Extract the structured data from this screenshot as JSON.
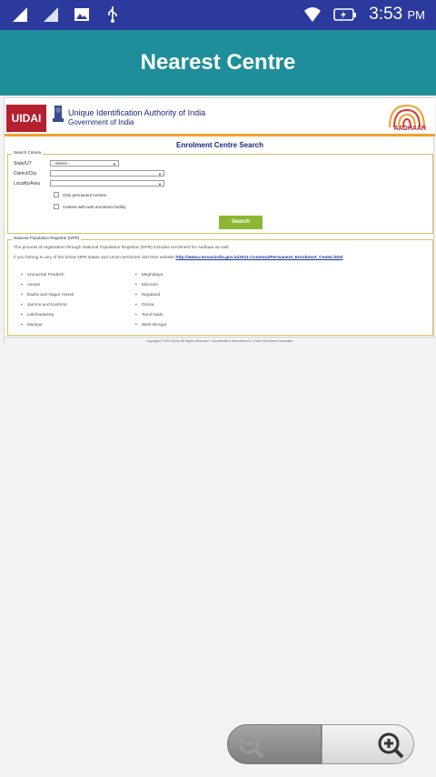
{
  "status_bar": {
    "time": "3:53",
    "ampm": "PM",
    "icons": [
      "signal-icon",
      "signal-r-icon",
      "image-icon",
      "usb-icon",
      "wifi-icon",
      "battery-icon"
    ]
  },
  "app_bar": {
    "title": "Nearest Centre"
  },
  "webpage": {
    "header": {
      "logo_text": "UIDAI",
      "authority_name": "Unique Identification Authority of India",
      "government_name": "Government of India",
      "aadhaar_logo_text": "AADHAAR"
    },
    "section_title": "Enrolment Centre Search",
    "search_criteria": {
      "legend": "Search Criteria",
      "state_label": "State/UT",
      "state_value": "--Select--",
      "district_label": "District/City",
      "district_value": "",
      "locality_label": "Locality/Area",
      "locality_value": "",
      "checkbox_permanent": "Only permanent centres",
      "checkbox_enrolment": "Centres with web enrolment facility",
      "search_button": "Search"
    },
    "npr": {
      "legend": "National Population Registrar (NPR)",
      "line1": "The process of registration through National Population Registrar (NPR) includes enrolment for Aadhaar as well.",
      "line2_prefix": "If you belong to any of the below NPR states and Union territories visit their website",
      "line2_link": "http://www.censusindia.gov.in/2011-Common/Permanent_Enrolment_Center.html",
      "states_col1": [
        "Arunachal Pradesh",
        "Assam",
        "Dadra and Nagar Haveli",
        "Jammu and Kashmir",
        "Lakshadweep",
        "Manipur"
      ],
      "states_col2": [
        "Meghalaya",
        "Mizoram",
        "Nagaland",
        "Orissa",
        "Tamil Nadu",
        "West Bengal"
      ]
    },
    "footer": "Copyright © 2010 UIDAI All Rights Reserved. The website is best viewed in 1 New  SW-screen resolution."
  },
  "zoom_controls": {
    "zoom_out_icon": "zoom-out-icon",
    "zoom_in_icon": "zoom-in-icon"
  },
  "colors": {
    "status_bar": "#2b3a9c",
    "app_bar": "#1e8f9a",
    "uidai_red": "#b5202e",
    "search_button": "#8ab832",
    "accent_orange": "#f0a030"
  }
}
